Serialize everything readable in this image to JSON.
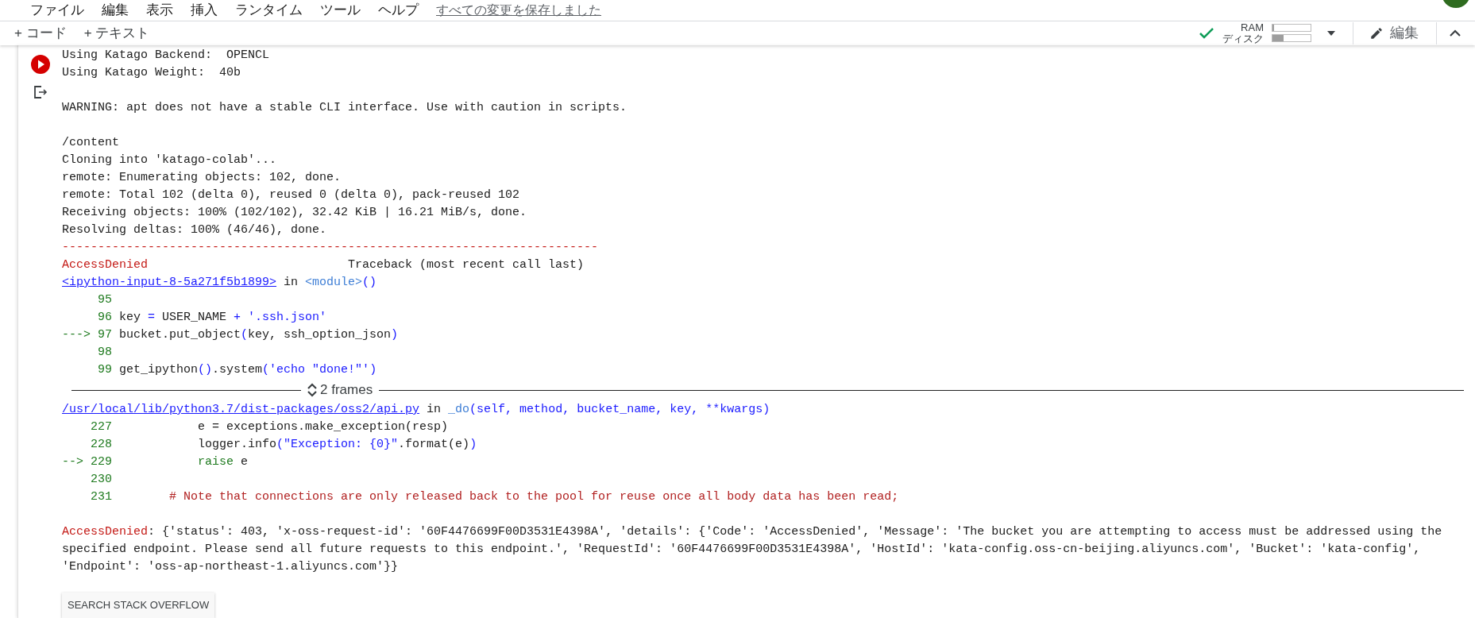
{
  "menu_bar": {
    "items": [
      "ファイル",
      "編集",
      "表示",
      "挿入",
      "ランタイム",
      "ツール",
      "ヘルプ"
    ],
    "save_status": "すべての変更を保存しました"
  },
  "toolbar": {
    "add_buttons": [
      "+ コード",
      "+ テキスト"
    ],
    "resources": [
      {
        "label": "RAM",
        "level": 0.05
      },
      {
        "label": "ディスク",
        "level": 0.3
      }
    ],
    "edit_button": "編集"
  },
  "output": {
    "lines": [
      {
        "segments": [
          {
            "text": "Using Katago Backend:  OPENCL",
            "kind": "plain"
          }
        ]
      },
      {
        "segments": [
          {
            "text": "Using Katago Weight:  40b",
            "kind": "plain"
          }
        ]
      },
      {
        "blank_before": true,
        "segments": [
          {
            "text": "WARNING: apt does not have a stable CLI interface. Use with caution in scripts.",
            "kind": "plain"
          }
        ]
      },
      {
        "blank_before": true,
        "segments": [
          {
            "text": "/content",
            "kind": "plain"
          }
        ]
      },
      {
        "segments": [
          {
            "text": "Cloning into 'katago-colab'...",
            "kind": "plain"
          }
        ]
      },
      {
        "segments": [
          {
            "text": "remote: Enumerating objects: 102, done.",
            "kind": "plain"
          }
        ]
      },
      {
        "segments": [
          {
            "text": "remote: Total 102 (delta 0), reused 0 (delta 0), pack-reused 102",
            "kind": "plain"
          }
        ]
      },
      {
        "segments": [
          {
            "text": "Receiving objects: 100% (102/102), 32.42 KiB | 16.21 MiB/s, done.",
            "kind": "plain"
          }
        ]
      },
      {
        "segments": [
          {
            "text": "Resolving deltas: 100% (46/46), done.",
            "kind": "plain"
          }
        ]
      },
      {
        "segments": [
          {
            "text": "---------------------------------------------------------------------------",
            "kind": "error"
          }
        ]
      },
      {
        "segments": [
          {
            "text": "AccessDenied",
            "kind": "error"
          },
          {
            "text": "                            Traceback (most recent call last)",
            "kind": "plain"
          }
        ]
      },
      {
        "segments": [
          {
            "text": "<ipython-input-8-5a271f5b1899>",
            "kind": "link"
          },
          {
            "text": " in ",
            "kind": "plain"
          },
          {
            "text": "<module>",
            "kind": "name"
          },
          {
            "text": "()",
            "kind": "operator"
          }
        ]
      },
      {
        "segments": [
          {
            "text": "     95",
            "kind": "number"
          }
        ]
      },
      {
        "segments": [
          {
            "text": "     96 ",
            "kind": "number"
          },
          {
            "text": "key ",
            "kind": "plain"
          },
          {
            "text": "=",
            "kind": "operator"
          },
          {
            "text": " USER_NAME ",
            "kind": "plain"
          },
          {
            "text": "+",
            "kind": "operator"
          },
          {
            "text": " '.ssh.json'",
            "kind": "string"
          }
        ]
      },
      {
        "segments": [
          {
            "text": "---> 97 ",
            "kind": "number"
          },
          {
            "text": "bucket.put_object",
            "kind": "plain"
          },
          {
            "text": "(",
            "kind": "operator"
          },
          {
            "text": "key, ssh_option_json",
            "kind": "plain"
          },
          {
            "text": ")",
            "kind": "operator"
          }
        ]
      },
      {
        "segments": [
          {
            "text": "     98",
            "kind": "number"
          }
        ]
      },
      {
        "segments": [
          {
            "text": "     99 ",
            "kind": "number"
          },
          {
            "text": "get_ipython",
            "kind": "plain"
          },
          {
            "text": "()",
            "kind": "operator"
          },
          {
            "text": ".system",
            "kind": "plain"
          },
          {
            "text": "(",
            "kind": "operator"
          },
          {
            "text": "'echo \"done!\"'",
            "kind": "string"
          },
          {
            "text": ")",
            "kind": "operator"
          }
        ]
      }
    ],
    "frames_label": "2 frames",
    "lines_after": [
      {
        "segments": [
          {
            "text": "/usr/local/lib/python3.7/dist-packages/oss2/api.py",
            "kind": "link"
          },
          {
            "text": " in ",
            "kind": "plain"
          },
          {
            "text": "_do",
            "kind": "name"
          },
          {
            "text": "(self, method, bucket_name, key, **kwargs)",
            "kind": "operator"
          }
        ]
      },
      {
        "segments": [
          {
            "text": "    227",
            "kind": "number"
          },
          {
            "text": "            e = exceptions.make_exception(resp)",
            "kind": "plain"
          }
        ]
      },
      {
        "segments": [
          {
            "text": "    228",
            "kind": "number"
          },
          {
            "text": "            logger.info",
            "kind": "plain"
          },
          {
            "text": "(",
            "kind": "operator"
          },
          {
            "text": "\"Exception: {0}\"",
            "kind": "string"
          },
          {
            "text": ".format(e)",
            "kind": "plain"
          },
          {
            "text": ")",
            "kind": "operator"
          }
        ]
      },
      {
        "segments": [
          {
            "text": "--> 229",
            "kind": "number"
          },
          {
            "text": "            raise",
            "kind": "keyword"
          },
          {
            "text": " e",
            "kind": "plain"
          }
        ]
      },
      {
        "segments": [
          {
            "text": "    230",
            "kind": "number"
          }
        ]
      },
      {
        "segments": [
          {
            "text": "    231",
            "kind": "number"
          },
          {
            "text": "        # Note that connections are only released back to the pool for reuse once all body data has been read;",
            "kind": "comment"
          }
        ]
      },
      {
        "blank_before": true,
        "segments": [
          {
            "text": "AccessDenied",
            "kind": "error"
          },
          {
            "text": ": {'status': 403, 'x-oss-request-id': '60F4476699F00D3531E4398A', 'details': {'Code': 'AccessDenied', 'Message': 'The bucket you are attempting to access must be addressed using the",
            "kind": "plain"
          }
        ]
      },
      {
        "segments": [
          {
            "text": "specified endpoint. Please send all future requests to this endpoint.', 'RequestId': '60F4476699F00D3531E4398A', 'HostId': 'kata-config.oss-cn-beijing.aliyuncs.com', 'Bucket': 'kata-config',",
            "kind": "plain"
          }
        ]
      },
      {
        "segments": [
          {
            "text": "'Endpoint': 'oss-ap-northeast-1.aliyuncs.com'}}",
            "kind": "plain"
          }
        ]
      }
    ],
    "search_button": "SEARCH STACK OVERFLOW"
  }
}
